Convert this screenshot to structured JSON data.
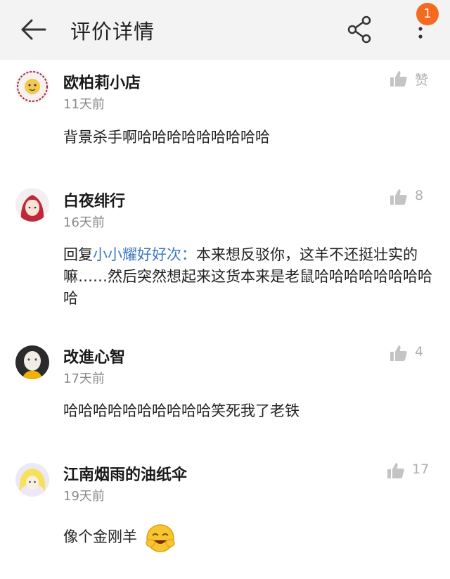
{
  "header": {
    "title": "评价详情",
    "badge": "1"
  },
  "comments": [
    {
      "user": "欧柏莉小店",
      "time": "11天前",
      "likes": "赞",
      "text": "背景杀手啊哈哈哈哈哈哈哈哈哈"
    },
    {
      "user": "白夜绯行",
      "time": "16天前",
      "likes": "8",
      "reply_prefix": "回复",
      "mention": "小小耀好好次：",
      "text": "本来想反驳你，这羊不还挺壮实的嘛……然后突然想起来这货本来是老鼠哈哈哈哈哈哈哈哈哈"
    },
    {
      "user": "改進心智",
      "time": "17天前",
      "likes": "4",
      "text": "哈哈哈哈哈哈哈哈哈哈笑死我了老铁"
    },
    {
      "user": "江南烟雨的油纸伞",
      "time": "19天前",
      "likes": "17",
      "text": "像个金刚羊"
    }
  ],
  "colors": {
    "header_bg": "#f3f3f3",
    "accent": "#f56a1f",
    "mention": "#3d77c7",
    "muted": "#8a8a8a"
  }
}
